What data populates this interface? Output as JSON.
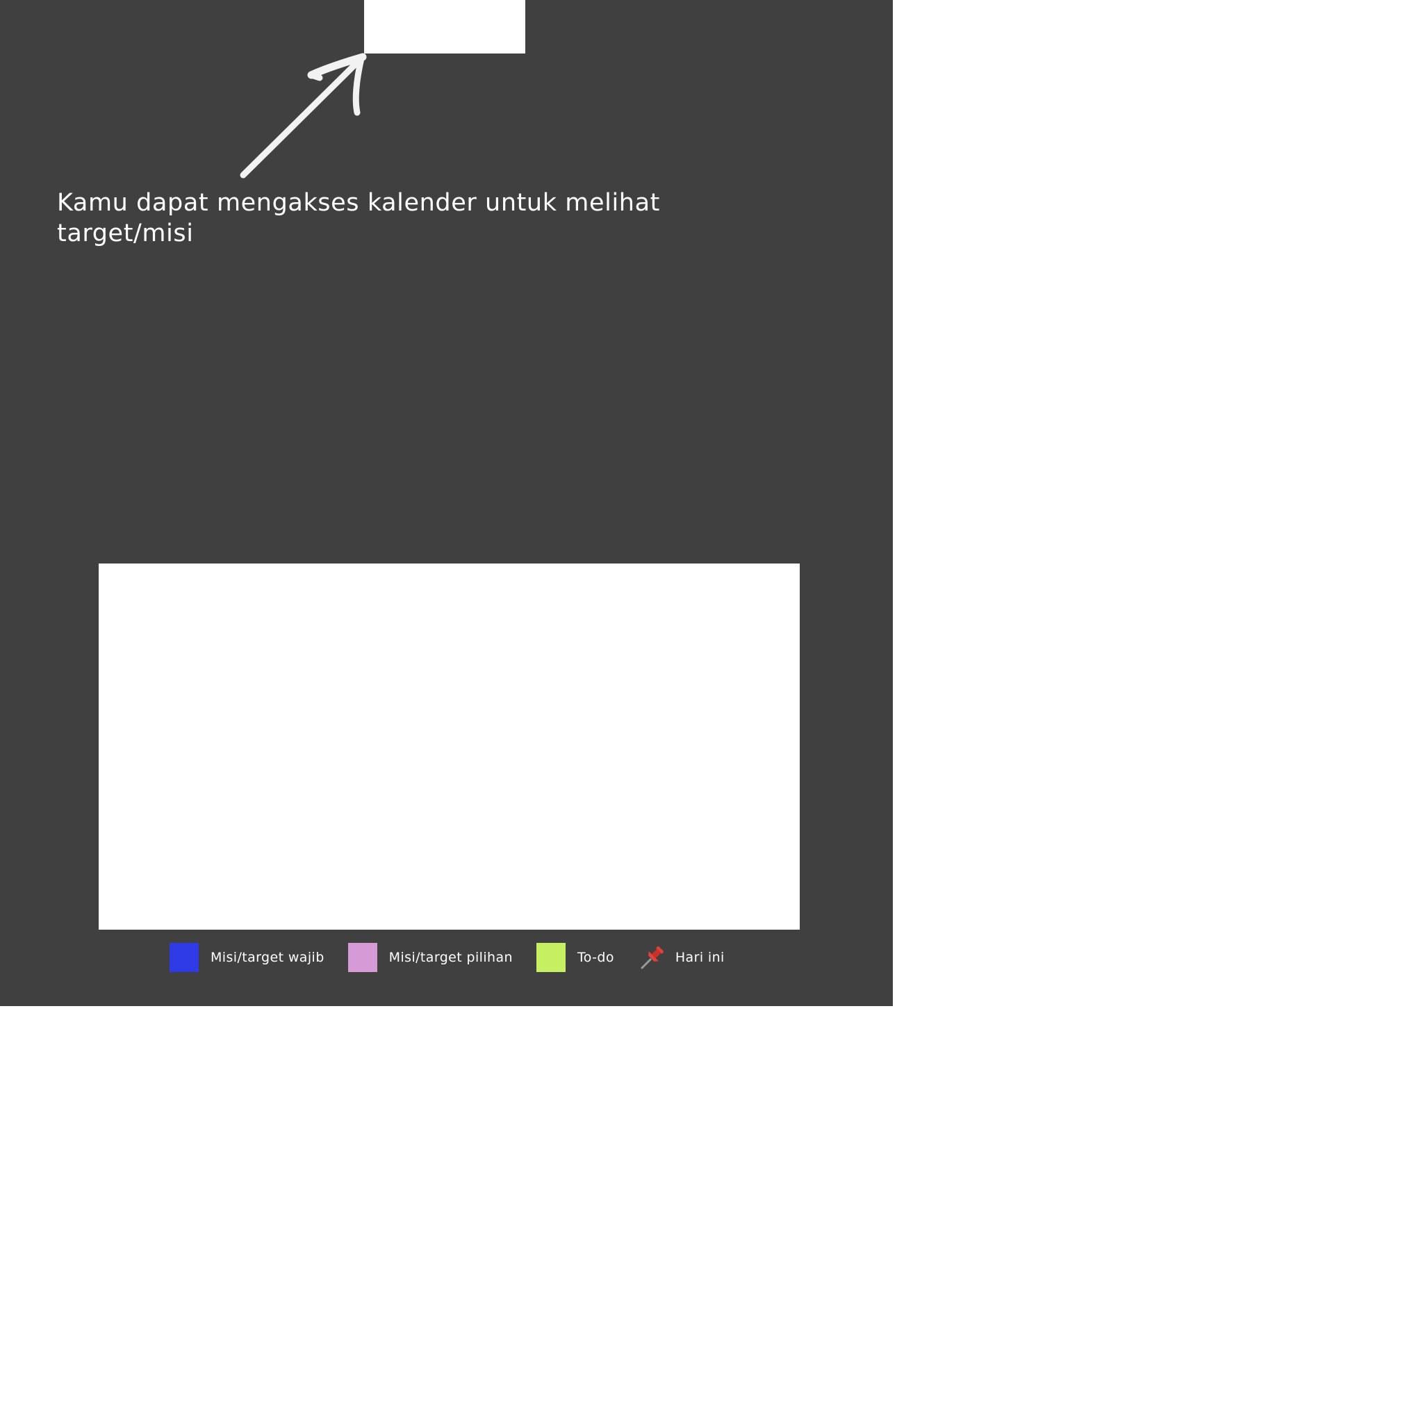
{
  "hint": {
    "text_line1": "Kamu dapat mengakses kalender untuk melihat",
    "text_line2": "target/misi"
  },
  "legend": {
    "items": [
      {
        "label": "Misi/target wajib",
        "color": "#2f3be6",
        "icon": "square-swatch"
      },
      {
        "label": "Misi/target pilihan",
        "color": "#d69bd6",
        "icon": "square-swatch"
      },
      {
        "label": "To-do",
        "color": "#c6f061",
        "icon": "square-swatch"
      },
      {
        "label": "Hari ini",
        "color": "#e0413a",
        "icon": "pushpin-icon"
      }
    ]
  },
  "colors": {
    "overlay": "#404040",
    "highlight": "#ffffff",
    "text": "#ffffff"
  }
}
